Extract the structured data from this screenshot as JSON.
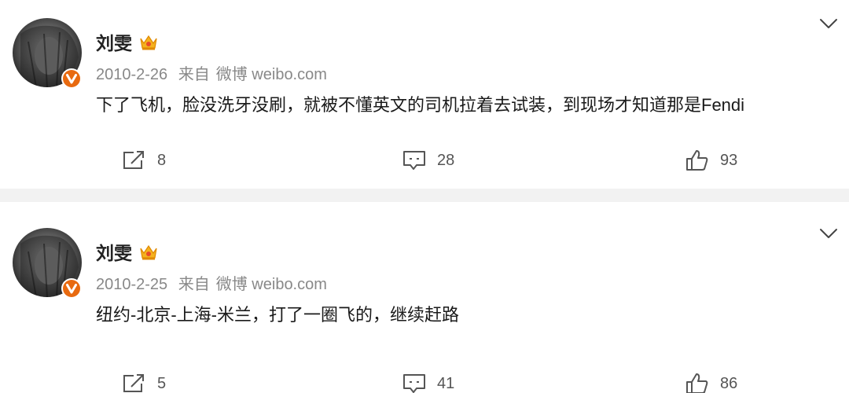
{
  "posts": [
    {
      "author": "刘雯",
      "date": "2010-2-26",
      "source_prefix": "来自",
      "source": "微博 weibo.com",
      "content": "下了飞机，脸没洗牙没刷，就被不懂英文的司机拉着去试装，到现场才知道那是Fendi",
      "reposts": "8",
      "comments": "28",
      "likes": "93"
    },
    {
      "author": "刘雯",
      "date": "2010-2-25",
      "source_prefix": "来自",
      "source": "微博 weibo.com",
      "content": "纽约-北京-上海-米兰，打了一圈飞的，继续赶路",
      "reposts": "5",
      "comments": "41",
      "likes": "86"
    }
  ],
  "icons": {
    "verified": "verified-v-badge-icon",
    "vip": "vip-crown-icon",
    "expand": "chevron-down-icon",
    "repost": "repost-icon",
    "comment": "comment-icon",
    "like": "thumbs-up-icon"
  },
  "colors": {
    "verified_badge": "#e86a10",
    "vip_crown": "#f5b21f",
    "separator": "#f2f2f2",
    "meta_text": "#888888",
    "action_text": "#555555"
  }
}
